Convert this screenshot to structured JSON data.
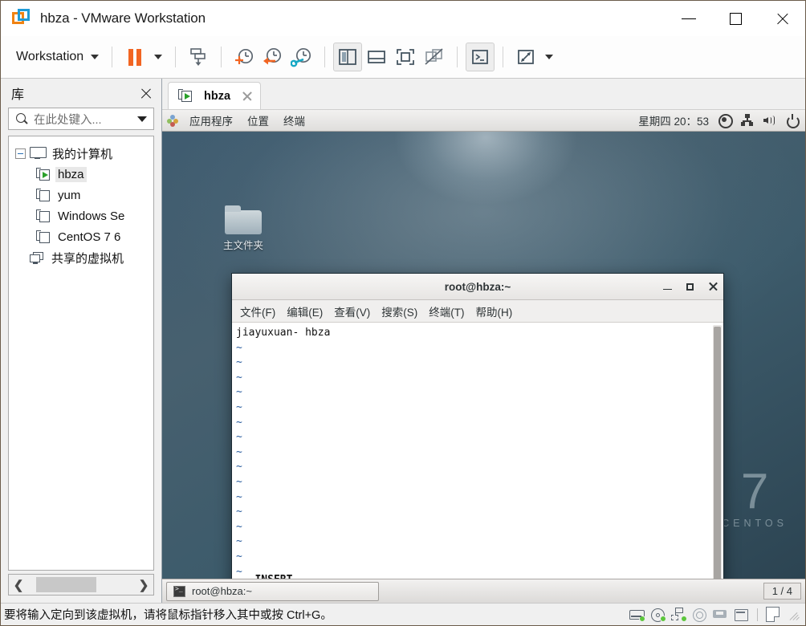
{
  "window": {
    "title": "hbza - VMware Workstation",
    "logo_icon": "vmware-logo-icon",
    "minimize_label": "minimize",
    "maximize_label": "maximize",
    "close_label": "close"
  },
  "toolbar": {
    "menu_label": "Workstation",
    "buttons": [
      {
        "name": "suspend-button",
        "icon": "pause-icon",
        "active": false
      },
      {
        "name": "power-dropdown",
        "icon": "chevron-down-icon",
        "active": false
      },
      {
        "name": "manage-button",
        "icon": "transfer-vm-icon",
        "active": false
      },
      {
        "name": "take-snapshot-button",
        "icon": "clock-plus-icon",
        "active": false
      },
      {
        "name": "revert-snapshot-button",
        "icon": "clock-back-icon",
        "active": false
      },
      {
        "name": "snapshot-manager-button",
        "icon": "clock-wrench-icon",
        "active": false
      },
      {
        "name": "show-library-button",
        "icon": "sidebar-panel-icon",
        "active": true
      },
      {
        "name": "show-thumbnail-bar-button",
        "icon": "bottom-panel-icon",
        "active": false
      },
      {
        "name": "fullscreen-button",
        "icon": "fullscreen-icon",
        "active": false
      },
      {
        "name": "unity-mode-button",
        "icon": "unity-disabled-icon",
        "active": false
      },
      {
        "name": "console-view-button",
        "icon": "terminal-prompt-icon",
        "active": true
      },
      {
        "name": "stretch-view-button",
        "icon": "expand-arrows-icon",
        "active": false
      },
      {
        "name": "view-dropdown",
        "icon": "chevron-down-icon",
        "active": false
      }
    ]
  },
  "sidebar": {
    "title": "库",
    "close_icon": "close-icon",
    "search": {
      "placeholder": "在此处键入...",
      "value": "",
      "icon": "search-icon",
      "dropdown_icon": "chevron-down-icon"
    },
    "tree": [
      {
        "label": "我的计算机",
        "icon": "monitor-icon",
        "level": 0,
        "expanded": true,
        "selected": false
      },
      {
        "label": "hbza",
        "icon": "vm-running-icon",
        "level": 1,
        "expanded": false,
        "selected": true
      },
      {
        "label": "yum",
        "icon": "vm-icon",
        "level": 1,
        "expanded": false,
        "selected": false
      },
      {
        "label": "Windows Se",
        "icon": "vm-icon",
        "level": 1,
        "expanded": false,
        "selected": false
      },
      {
        "label": "CentOS 7 6",
        "icon": "vm-icon",
        "level": 1,
        "expanded": false,
        "selected": false
      },
      {
        "label": "共享的虚拟机",
        "icon": "shared-vms-icon",
        "level": 0,
        "expanded": false,
        "selected": false
      }
    ],
    "scroll_left_icon": "chevron-left-icon",
    "scroll_right_icon": "chevron-right-icon"
  },
  "vm_tab": {
    "label": "hbza",
    "icon": "vm-running-icon",
    "close_icon": "close-icon"
  },
  "guest": {
    "panel": {
      "apps_icon": "gnome-applications-icon",
      "menus": [
        "应用程序",
        "位置",
        "终端"
      ],
      "clock": "星期四 20：53",
      "tray_icons": [
        "record-icon",
        "network-icon",
        "volume-icon",
        "power-icon"
      ]
    },
    "desktop": {
      "icon_label": "主文件夹",
      "icon_name": "home-folder-icon",
      "watermark_number": "7",
      "watermark_word": "CENTOS"
    },
    "terminal": {
      "title": "root@hbza:~",
      "menus": [
        "文件(F)",
        "编辑(E)",
        "查看(V)",
        "搜索(S)",
        "终端(T)",
        "帮助(H)"
      ],
      "minimize_icon": "minimize-icon",
      "maximize_icon": "maximize-icon",
      "close_icon": "close-icon",
      "first_line": "jiayuxuan- hbza",
      "tilde": "~",
      "tilde_rows": 16,
      "status_line": "-- INSERT --"
    },
    "taskbar": {
      "window_label": "root@hbza:~",
      "window_icon": "terminal-icon",
      "workspace_indicator": "1 / 4"
    }
  },
  "statusbar": {
    "message": "要将输入定向到该虚拟机，请将鼠标指针移入其中或按 Ctrl+G。",
    "devices": [
      {
        "name": "hard-disk-device-icon",
        "active": true
      },
      {
        "name": "cd-dvd-device-icon",
        "active": true
      },
      {
        "name": "network-adapter-device-icon",
        "active": true
      },
      {
        "name": "sound-card-device-icon",
        "active": false
      },
      {
        "name": "usb-device-icon",
        "active": false
      },
      {
        "name": "printer-device-icon",
        "active": false
      }
    ],
    "message_icon": "message-log-icon",
    "resize_grip": "resize-grip-icon"
  },
  "colors": {
    "accent_orange": "#f26522",
    "accent_blue": "#1e9bd7",
    "vm_running_green": "#2aa02a",
    "led_green": "#5cc63c"
  }
}
